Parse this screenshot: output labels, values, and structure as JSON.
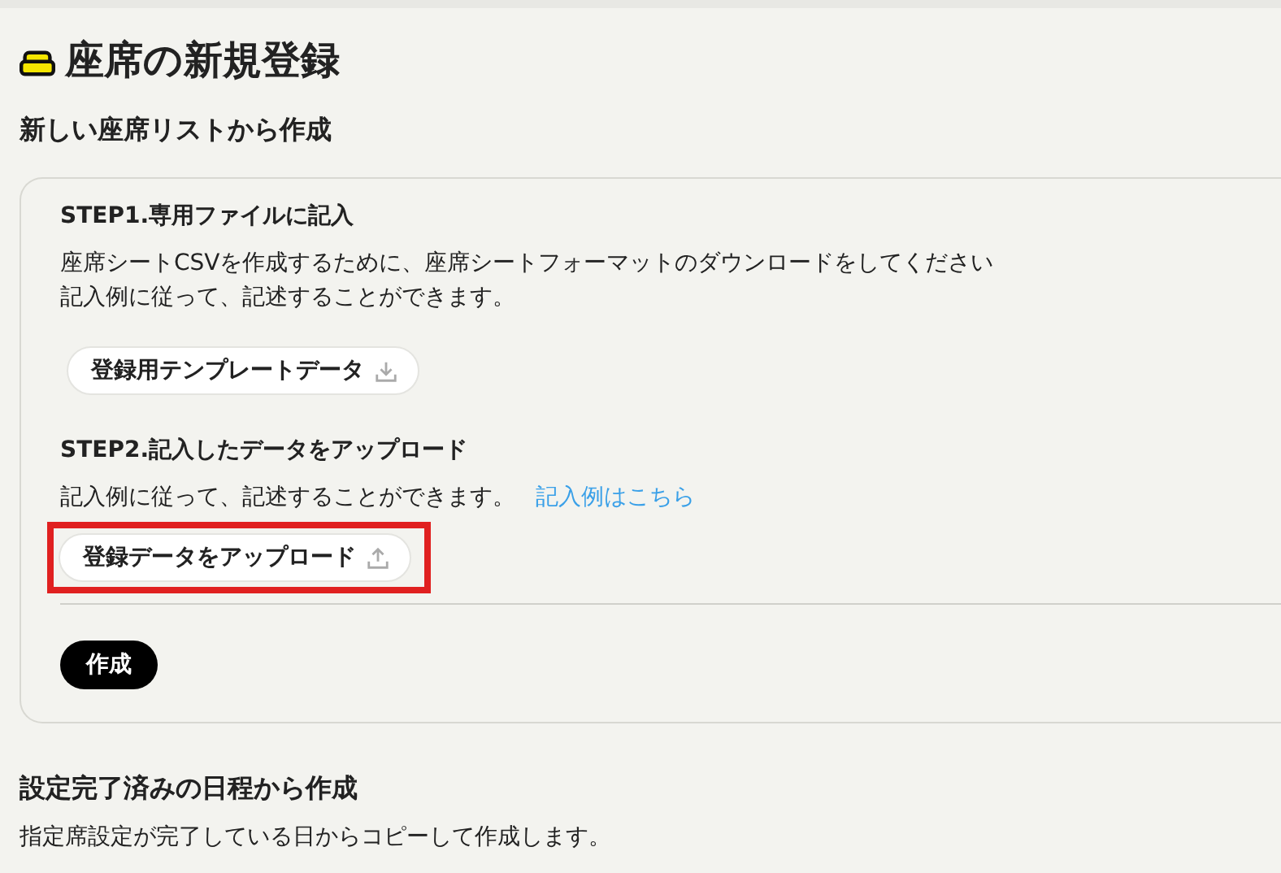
{
  "page_title": "座席の新規登録",
  "new_list_section": {
    "heading": "新しい座席リストから作成",
    "steps": [
      {
        "kind": "download",
        "title": "STEP1.専用ファイルに記入",
        "lines": [
          "座席シートCSVを作成するために、座席シートフォーマットのダウンロードをしてください",
          "記入例に従って、記述することができます。"
        ],
        "button": "登録用テンプレートデータ",
        "highlighted": false
      },
      {
        "kind": "upload",
        "title": "STEP2.記入したデータをアップロード",
        "lines": [
          "記入例に従って、記述することができます。"
        ],
        "link": "記入例はこちら",
        "button": "登録データをアップロード",
        "highlighted": true
      }
    ],
    "create_button": "作成"
  },
  "copy_section": {
    "heading": "設定完了済みの日程から作成",
    "description": "指定席設定が完了している日からコピーして作成します。"
  }
}
